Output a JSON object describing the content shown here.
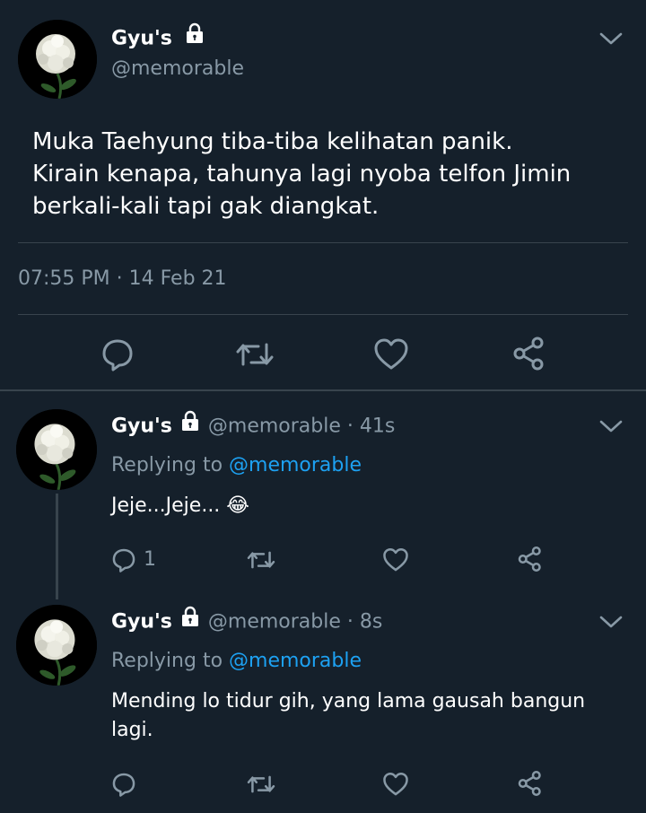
{
  "main_tweet": {
    "display_name": "Gyu's",
    "handle": "@memorable",
    "text_lines": [
      "Muka Taehyung tiba-tiba kelihatan panik.",
      "Kirain kenapa, tahunya lagi nyoba telfon Jimin",
      "berkali-kali tapi gak diangkat."
    ],
    "timestamp": "07:55 PM · 14 Feb 21",
    "actions": [
      "reply-icon",
      "retweet-icon",
      "like-icon",
      "share-icon"
    ]
  },
  "replies": [
    {
      "display_name": "Gyu's",
      "handle_time": "@memorable · 41s",
      "replying_prefix": "Replying to ",
      "replying_handle": "@memorable",
      "text_lines": [
        "Jeje...Jeje... 😂"
      ],
      "reply_count": "1"
    },
    {
      "display_name": "Gyu's",
      "handle_time": "@memorable · 8s",
      "replying_prefix": "Replying to ",
      "replying_handle": "@memorable",
      "text_lines": [
        "Mending lo tidur gih, yang lama gausah bangun",
        "lagi."
      ],
      "reply_count": ""
    }
  ],
  "colors": {
    "background": "#15202b",
    "secondary_text": "#8899a6",
    "link": "#1da1f2",
    "divider": "#38444d"
  }
}
